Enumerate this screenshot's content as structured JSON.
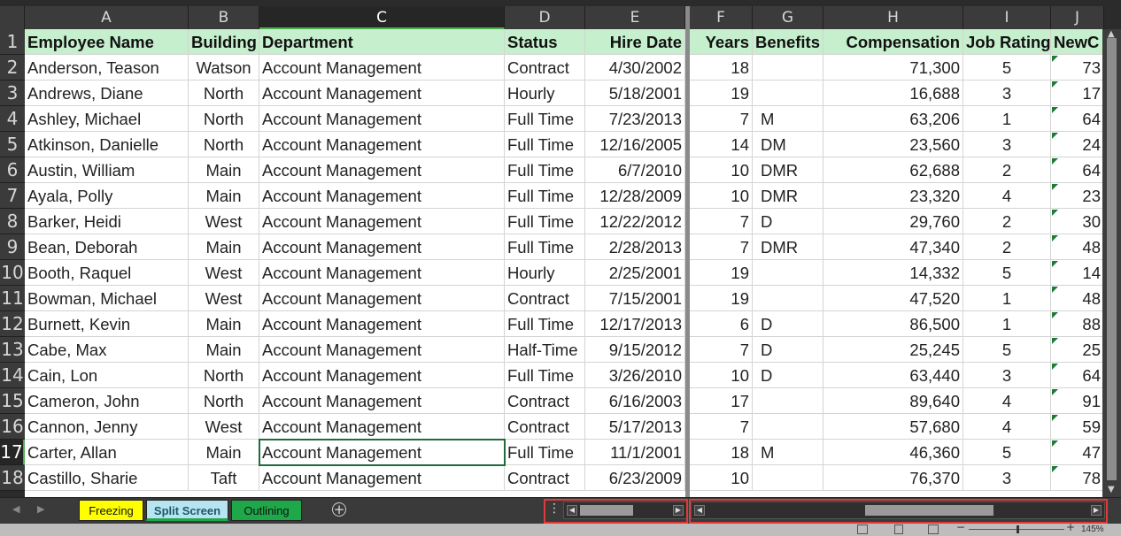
{
  "columns": [
    {
      "letter": "A"
    },
    {
      "letter": "B"
    },
    {
      "letter": "C"
    },
    {
      "letter": "D"
    },
    {
      "letter": "E"
    },
    {
      "letter": "F"
    },
    {
      "letter": "G"
    },
    {
      "letter": "H"
    },
    {
      "letter": "I"
    },
    {
      "letter": "J"
    }
  ],
  "row_numbers": [
    "1",
    "2",
    "3",
    "4",
    "5",
    "6",
    "7",
    "8",
    "9",
    "10",
    "11",
    "12",
    "13",
    "14",
    "15",
    "16",
    "17",
    "18"
  ],
  "header": {
    "employee_name": "Employee Name",
    "building": "Building",
    "department": "Department",
    "status": "Status",
    "hire_date": "Hire Date",
    "years": "Years",
    "benefits": "Benefits",
    "compensation": "Compensation",
    "job_rating": "Job Rating",
    "newc": "NewC"
  },
  "rows": [
    {
      "name": "Anderson, Teason",
      "building": "Watson",
      "dept": "Account Management",
      "status": "Contract",
      "hire": "4/30/2002",
      "years": "18",
      "benefits": "",
      "comp": "71,300",
      "rating": "5",
      "newc": "73"
    },
    {
      "name": "Andrews, Diane",
      "building": "North",
      "dept": "Account Management",
      "status": "Hourly",
      "hire": "5/18/2001",
      "years": "19",
      "benefits": "",
      "comp": "16,688",
      "rating": "3",
      "newc": "17"
    },
    {
      "name": "Ashley, Michael",
      "building": "North",
      "dept": "Account Management",
      "status": "Full Time",
      "hire": "7/23/2013",
      "years": "7",
      "benefits": "M",
      "comp": "63,206",
      "rating": "1",
      "newc": "64"
    },
    {
      "name": "Atkinson, Danielle",
      "building": "North",
      "dept": "Account Management",
      "status": "Full Time",
      "hire": "12/16/2005",
      "years": "14",
      "benefits": "DM",
      "comp": "23,560",
      "rating": "3",
      "newc": "24"
    },
    {
      "name": "Austin, William",
      "building": "Main",
      "dept": "Account Management",
      "status": "Full Time",
      "hire": "6/7/2010",
      "years": "10",
      "benefits": "DMR",
      "comp": "62,688",
      "rating": "2",
      "newc": "64"
    },
    {
      "name": "Ayala, Polly",
      "building": "Main",
      "dept": "Account Management",
      "status": "Full Time",
      "hire": "12/28/2009",
      "years": "10",
      "benefits": "DMR",
      "comp": "23,320",
      "rating": "4",
      "newc": "23"
    },
    {
      "name": "Barker, Heidi",
      "building": "West",
      "dept": "Account Management",
      "status": "Full Time",
      "hire": "12/22/2012",
      "years": "7",
      "benefits": "D",
      "comp": "29,760",
      "rating": "2",
      "newc": "30"
    },
    {
      "name": "Bean, Deborah",
      "building": "Main",
      "dept": "Account Management",
      "status": "Full Time",
      "hire": "2/28/2013",
      "years": "7",
      "benefits": "DMR",
      "comp": "47,340",
      "rating": "2",
      "newc": "48"
    },
    {
      "name": "Booth, Raquel",
      "building": "West",
      "dept": "Account Management",
      "status": "Hourly",
      "hire": "2/25/2001",
      "years": "19",
      "benefits": "",
      "comp": "14,332",
      "rating": "5",
      "newc": "14"
    },
    {
      "name": "Bowman, Michael",
      "building": "West",
      "dept": "Account Management",
      "status": "Contract",
      "hire": "7/15/2001",
      "years": "19",
      "benefits": "",
      "comp": "47,520",
      "rating": "1",
      "newc": "48"
    },
    {
      "name": "Burnett, Kevin",
      "building": "Main",
      "dept": "Account Management",
      "status": "Full Time",
      "hire": "12/17/2013",
      "years": "6",
      "benefits": "D",
      "comp": "86,500",
      "rating": "1",
      "newc": "88"
    },
    {
      "name": "Cabe, Max",
      "building": "Main",
      "dept": "Account Management",
      "status": "Half-Time",
      "hire": "9/15/2012",
      "years": "7",
      "benefits": "D",
      "comp": "25,245",
      "rating": "5",
      "newc": "25"
    },
    {
      "name": "Cain, Lon",
      "building": "North",
      "dept": "Account Management",
      "status": "Full Time",
      "hire": "3/26/2010",
      "years": "10",
      "benefits": "D",
      "comp": "63,440",
      "rating": "3",
      "newc": "64"
    },
    {
      "name": "Cameron, John",
      "building": "North",
      "dept": "Account Management",
      "status": "Contract",
      "hire": "6/16/2003",
      "years": "17",
      "benefits": "",
      "comp": "89,640",
      "rating": "4",
      "newc": "91"
    },
    {
      "name": "Cannon, Jenny",
      "building": "West",
      "dept": "Account Management",
      "status": "Contract",
      "hire": "5/17/2013",
      "years": "7",
      "benefits": "",
      "comp": "57,680",
      "rating": "4",
      "newc": "59"
    },
    {
      "name": "Carter, Allan",
      "building": "Main",
      "dept": "Account Management",
      "status": "Full Time",
      "hire": "11/1/2001",
      "years": "18",
      "benefits": "M",
      "comp": "46,360",
      "rating": "5",
      "newc": "47"
    },
    {
      "name": "Castillo, Sharie",
      "building": "Taft",
      "dept": "Account Management",
      "status": "Contract",
      "hire": "6/23/2009",
      "years": "10",
      "benefits": "",
      "comp": "76,370",
      "rating": "3",
      "newc": "78"
    }
  ],
  "sheet_tabs": [
    {
      "label": "Freezing",
      "color": "#ffff00"
    },
    {
      "label": "Split Screen",
      "color": "#b7e4f0"
    },
    {
      "label": "Outlining",
      "color": "#1ea84a"
    }
  ],
  "status": {
    "zoom": "145%"
  }
}
